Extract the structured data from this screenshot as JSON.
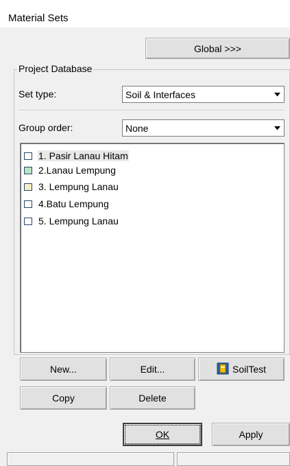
{
  "window": {
    "title": "Material Sets"
  },
  "buttons": {
    "global": "Global >>>",
    "new": "New...",
    "edit": "Edit...",
    "soiltest": "SoilTest",
    "copy": "Copy",
    "delete": "Delete",
    "ok": "OK",
    "apply": "Apply"
  },
  "project_database": {
    "group_label": "Project Database",
    "set_type": {
      "label": "Set type:",
      "value": "Soil & Interfaces"
    },
    "group_order": {
      "label": "Group order:",
      "value": "None"
    },
    "materials": [
      {
        "label": "1. Pasir Lanau Hitam",
        "color": "#ffffff",
        "selected": true
      },
      {
        "label": "2.Lanau Lempung",
        "color": "#b9e3c5",
        "selected": false
      },
      {
        "label": "3. Lempung Lanau",
        "color": "#f6f0c8",
        "selected": false
      },
      {
        "label": "4.Batu Lempung",
        "color": "#ffffff",
        "selected": false
      },
      {
        "label": "5. Lempung Lanau",
        "color": "#ffffff",
        "selected": false
      }
    ]
  },
  "colors": {
    "window_bg": "#f0f0f0",
    "button_bg": "#e1e1e1",
    "swatch_border": "#2a4466"
  },
  "icons": {
    "soiltest": "soiltest-icon",
    "dropdown": "chevron-down-icon"
  }
}
